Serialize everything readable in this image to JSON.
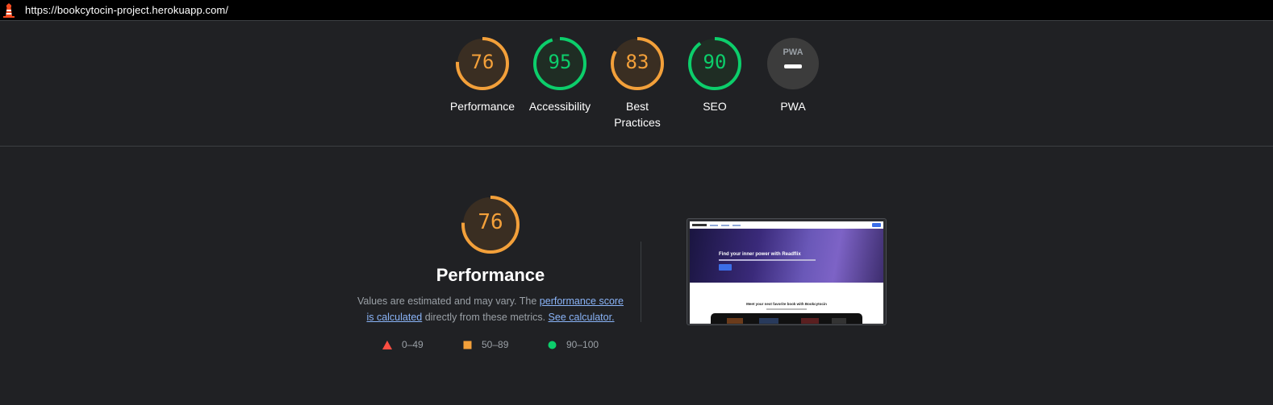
{
  "address_bar": {
    "url": "https://bookcytocin-project.herokuapp.com/",
    "icon": "lighthouse-icon"
  },
  "colors": {
    "average": "#f3a03a",
    "pass": "#0cce6b",
    "fail": "#ff4e42",
    "background": "#202124",
    "link": "#8ab4f8"
  },
  "categories": [
    {
      "label": "Performance",
      "score": "76",
      "score_value": 76,
      "rating": "average"
    },
    {
      "label": "Accessibility",
      "score": "95",
      "score_value": 95,
      "rating": "pass"
    },
    {
      "label": "Best Practices",
      "score": "83",
      "score_value": 83,
      "rating": "average"
    },
    {
      "label": "SEO",
      "score": "90",
      "score_value": 90,
      "rating": "pass"
    },
    {
      "label": "PWA",
      "badge_text": "PWA",
      "icon": "pwa-badge-icon"
    }
  ],
  "detail": {
    "score": "76",
    "score_value": 76,
    "title": "Performance",
    "desc_prefix": "Values are estimated and may vary. The ",
    "link1": "performance score is calculated",
    "desc_middle": " directly from these metrics. ",
    "link2": "See calculator.",
    "legend": [
      {
        "range": "0–49",
        "shape": "triangle",
        "rating": "fail"
      },
      {
        "range": "50–89",
        "shape": "square",
        "rating": "average"
      },
      {
        "range": "90–100",
        "shape": "circle",
        "rating": "pass"
      }
    ]
  },
  "screenshot": {
    "hero_heading": "Find your inner power with Readflix",
    "section_heading": "Meet your next favorite book with Bookcytocin"
  }
}
